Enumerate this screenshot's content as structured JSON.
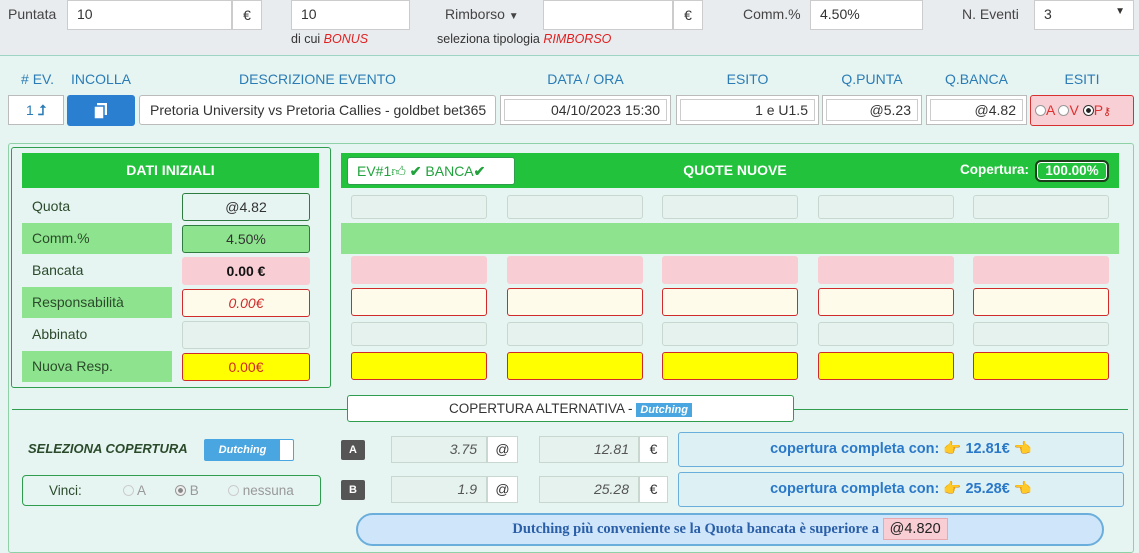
{
  "top": {
    "puntata_label": "Puntata",
    "puntata_value": "10",
    "euro": "€",
    "bonus_value": "10",
    "bonus_note_prefix": "di cui ",
    "bonus_note_red": "BONUS",
    "rimborso_label": "Rimborso",
    "rimborso_value": "",
    "rimborso_note_prefix": "seleziona tipologia ",
    "rimborso_note_red": "RIMBORSO",
    "comm_label": "Comm.%",
    "comm_value": "4.50%",
    "neventi_label": "N. Eventi",
    "neventi_value": "3"
  },
  "headers": [
    "# EV.",
    "INCOLLA",
    "DESCRIZIONE EVENTO",
    "DATA / ORA",
    "ESITO",
    "Q.PUNTA",
    "Q.BANCA",
    "ESITI"
  ],
  "event": {
    "num": "1",
    "arrow": "⮥",
    "desc": "Pretoria University vs Pretoria Callies - goldbet bet365",
    "datetime": "04/10/2023 15:30",
    "esito": "1 e U1.5",
    "qpunta": "@5.23",
    "qbanca": "@4.82",
    "esiti_a": "A",
    "esiti_v": "V",
    "esiti_p": "P"
  },
  "dati": {
    "title": "DATI INIZIALI",
    "rows": [
      {
        "label": "Quota",
        "value": "@4.82"
      },
      {
        "label": "Comm.%",
        "value": "4.50%"
      },
      {
        "label": "Bancata",
        "value": "0.00 €"
      },
      {
        "label": "Responsabilità",
        "value": "0.00€"
      },
      {
        "label": "Abbinato",
        "value": ""
      },
      {
        "label": "Nuova Resp.",
        "value": "0.00€"
      }
    ]
  },
  "quote": {
    "ev_label": "EV#1",
    "banca_label": "BANCA",
    "title": "QUOTE NUOVE",
    "copertura_label": "Copertura:",
    "copertura_value": "100.00%"
  },
  "alt": {
    "title": "COPERTURA ALTERNATIVA - ",
    "badge": "Dutching",
    "seleziona": "SELEZIONA COPERTURA",
    "toggle": "Dutching",
    "vinci": "Vinci:",
    "opt_a": "A",
    "opt_b": "B",
    "opt_none": "nessuna",
    "rowA": {
      "tag": "A",
      "quota": "3.75",
      "at": "@",
      "amount": "12.81",
      "euro": "€",
      "msg": "copertura completa con:",
      "val": "12.81€"
    },
    "rowB": {
      "tag": "B",
      "quota": "1.9",
      "at": "@",
      "amount": "25.28",
      "euro": "€",
      "msg": "copertura completa con:",
      "val": "25.28€"
    },
    "footer": "Dutching più conveniente se la Quota bancata è superiore a ",
    "footer_val": "@4.820"
  },
  "colors": {
    "green": "#22c23c",
    "lightgreen": "#8ee48e",
    "pink": "#f8cdd3",
    "yellow": "#ffff00",
    "blue": "#2a78c8"
  }
}
